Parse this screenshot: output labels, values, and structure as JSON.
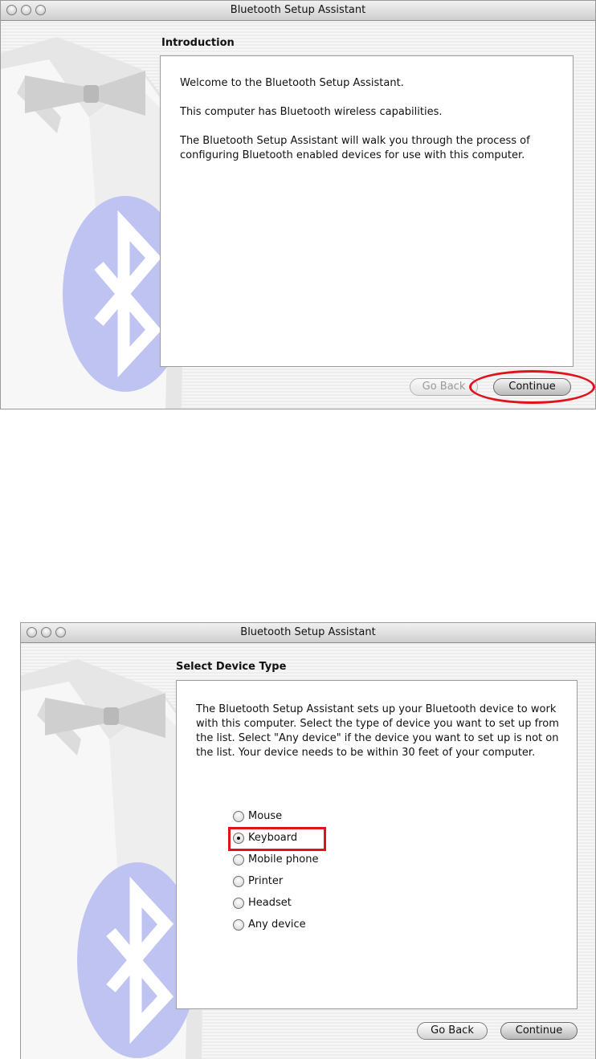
{
  "window1": {
    "title": "Bluetooth Setup Assistant",
    "step_title": "Introduction",
    "paragraphs": [
      "Welcome to the Bluetooth Setup Assistant.",
      "This computer has Bluetooth wireless capabilities.",
      "The Bluetooth Setup Assistant will walk you through the process of configuring Bluetooth enabled devices for use with this computer."
    ],
    "go_back_label": "Go Back",
    "continue_label": "Continue"
  },
  "window2": {
    "title": "Bluetooth Setup Assistant",
    "step_title": "Select Device Type",
    "description": "The Bluetooth Setup Assistant sets up your Bluetooth device to work with this computer. Select the type of device you want to set up from the list. Select \"Any device\" if the device you want to set up is not on the list. Your device needs to be within 30 feet of your computer.",
    "options": [
      {
        "label": "Mouse",
        "selected": false
      },
      {
        "label": "Keyboard",
        "selected": true
      },
      {
        "label": "Mobile phone",
        "selected": false
      },
      {
        "label": "Printer",
        "selected": false
      },
      {
        "label": "Headset",
        "selected": false
      },
      {
        "label": "Any device",
        "selected": false
      }
    ],
    "go_back_label": "Go Back",
    "continue_label": "Continue"
  },
  "colors": {
    "highlight": "#e0121b",
    "bluetooth_badge": "#bfc3f2"
  }
}
